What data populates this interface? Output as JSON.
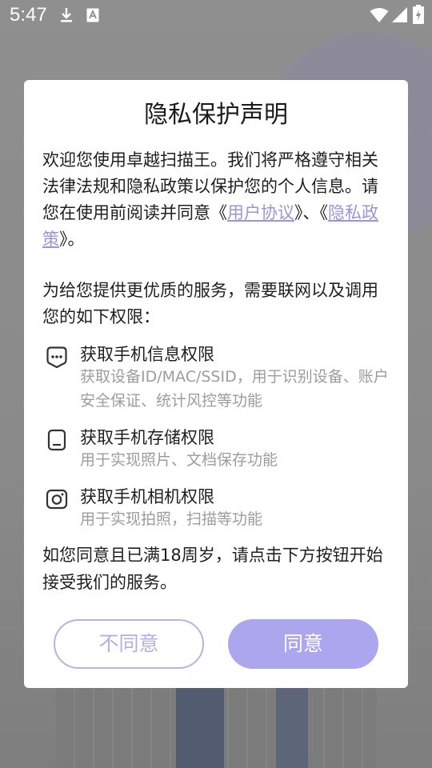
{
  "status_bar": {
    "time": "5:47",
    "icons": [
      "download-icon",
      "a-notification-icon",
      "wifi-icon",
      "signal-icon",
      "battery-charging-icon"
    ]
  },
  "dialog": {
    "title": "隐私保护声明",
    "intro": {
      "text_before": "欢迎您使用卓越扫描王。我们将严格遵守相关法律法规和隐私政策以保护您的个人信息。请您在使用前阅读并同意《",
      "user_agreement_link": "用户协议",
      "text_middle": "》、《",
      "privacy_policy_link": "隐私政策",
      "text_after": "》。"
    },
    "service_intro": "为给您提供更优质的服务，需要联网以及调用您的如下权限：",
    "permissions": [
      {
        "icon": "phone-info-icon",
        "title": "获取手机信息权限",
        "description": "获取设备ID/MAC/SSID，用于识别设备、账户安全保证、统计风控等功能"
      },
      {
        "icon": "storage-icon",
        "title": "获取手机存储权限",
        "description": "用于实现照片、文档保存功能"
      },
      {
        "icon": "camera-icon",
        "title": "获取手机相机权限",
        "description": "用于实现拍照，扫描等功能"
      }
    ],
    "age_notice": "如您同意且已满18周岁，请点击下方按钮开始接受我们的服务。",
    "buttons": {
      "disagree": "不同意",
      "agree": "同意"
    }
  },
  "colors": {
    "accent": "#aba6ee",
    "link": "#9a95d8",
    "overlay": "#8d8d8d"
  }
}
